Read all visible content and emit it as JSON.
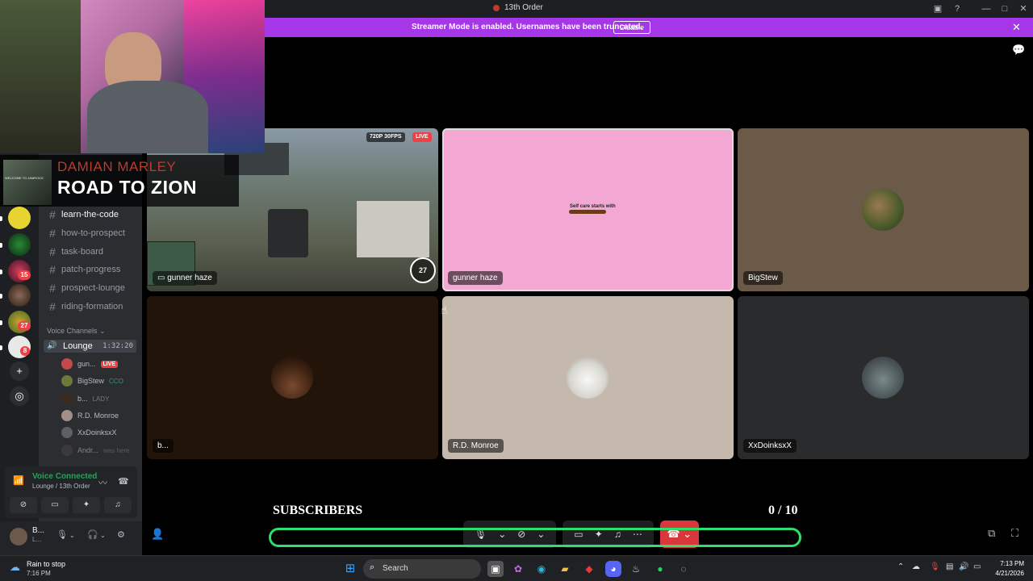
{
  "window": {
    "title": "13th Order"
  },
  "banner": {
    "message": "Streamer Mode is enabled. Usernames have been truncated.",
    "disable_label": "Disable"
  },
  "rail": {
    "badges": [
      "15",
      "27",
      "8"
    ]
  },
  "sidebar": {
    "channels": [
      {
        "name": "learn-the-code",
        "active": true
      },
      {
        "name": "how-to-prospect"
      },
      {
        "name": "task-board"
      },
      {
        "name": "patch-progress"
      },
      {
        "name": "prospect-lounge"
      },
      {
        "name": "riding-formation"
      }
    ],
    "voice_header": "Voice Channels",
    "lounge": {
      "name": "Lounge",
      "time": "1:32:20"
    },
    "voice_users": [
      {
        "name": "gun...",
        "live": "LIVE",
        "color": "#c24a4a"
      },
      {
        "name": "BigStew",
        "color": "#6a7a3a",
        "extra": "CCO"
      },
      {
        "name": "b...",
        "color": "#3a2a20",
        "extra": "LADY"
      },
      {
        "name": "R.D. Monroe",
        "color": "#a09088"
      },
      {
        "name": "XxDoinksxX",
        "color": "#5a6066"
      },
      {
        "name": "Andr...",
        "color": "#444",
        "extra": "was here"
      }
    ]
  },
  "voice_panel": {
    "status": "Voice Connected",
    "location": "Lounge / 13th Order"
  },
  "user": {
    "name": "B...",
    "status": "L..."
  },
  "tiles": [
    {
      "name": "gunner haze",
      "quality": "720P 30FPS",
      "live": "LIVE",
      "speed": "27"
    },
    {
      "name": "gunner haze",
      "caption": "Self care starts with"
    },
    {
      "name": "BigStew"
    },
    {
      "name": "b..."
    },
    {
      "name": "R.D. Monroe"
    },
    {
      "name": "XxDoinksxX"
    }
  ],
  "now_playing": {
    "artist": "DAMIAN MARLEY",
    "song": "ROAD TO ZION",
    "album_text": "WELCOME TO JAMROCK"
  },
  "subscribers": {
    "label": "SUBSCRIBERS",
    "count_text": "0 / 10",
    "progress": 0
  },
  "taskbar": {
    "weather_title": "Rain to stop",
    "weather_time": "7:16 PM",
    "search_placeholder": "Search",
    "time": "7:13 PM",
    "date": "4/21/2026"
  },
  "colors": {
    "accent_banner": "#a537e8",
    "hangup": "#da373c",
    "progress_border": "#2ee06a",
    "tile_pink": "#f2a8d2",
    "tile_brown": "#6b5a47",
    "tile_dark": "#221409",
    "tile_beige": "#c5b9ae",
    "tile_grey": "#2a2b2d"
  }
}
